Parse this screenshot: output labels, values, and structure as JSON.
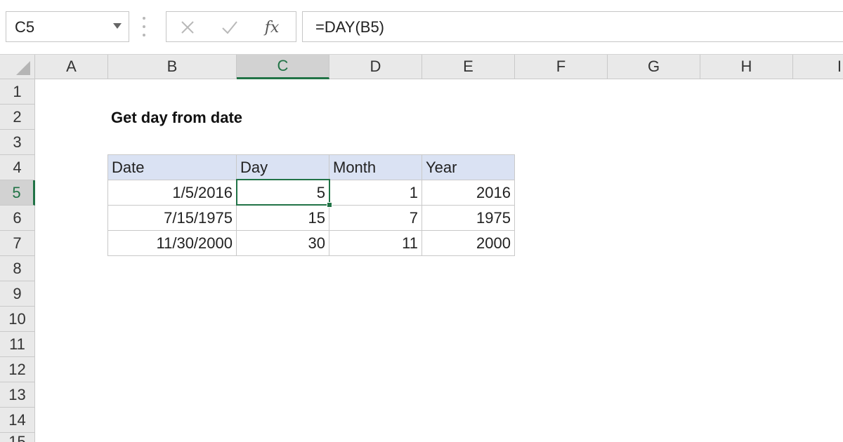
{
  "formula_bar": {
    "name_box": "C5",
    "formula": "=DAY(B5)",
    "fx_label": "fx"
  },
  "columns": [
    "A",
    "B",
    "C",
    "D",
    "E",
    "F",
    "G",
    "H",
    "I"
  ],
  "rows": [
    "1",
    "2",
    "3",
    "4",
    "5",
    "6",
    "7",
    "8",
    "9",
    "10",
    "11",
    "12",
    "13",
    "14",
    "15"
  ],
  "active_cell": {
    "column": "C",
    "row": "5"
  },
  "sheet": {
    "title": "Get day from date",
    "table": {
      "headers": [
        "Date",
        "Day",
        "Month",
        "Year"
      ],
      "rows": [
        [
          "1/5/2016",
          "5",
          "1",
          "2016"
        ],
        [
          "7/15/1975",
          "15",
          "7",
          "1975"
        ],
        [
          "11/30/2000",
          "30",
          "11",
          "2000"
        ]
      ]
    }
  },
  "colors": {
    "accent": "#217346",
    "header_fill": "#dae2f3",
    "gridline": "#c9c9c9"
  }
}
